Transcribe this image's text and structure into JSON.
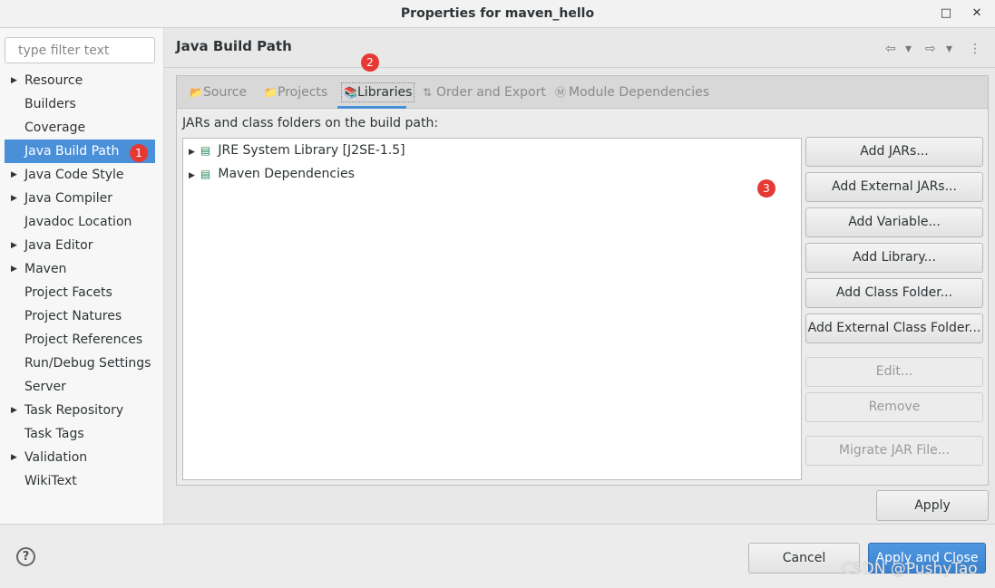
{
  "window": {
    "title": "Properties for maven_hello",
    "minimize": "▫",
    "close": "✕"
  },
  "sidebar": {
    "filter_placeholder": "type filter text",
    "items": [
      {
        "label": "Resource",
        "expandable": true
      },
      {
        "label": "Builders",
        "expandable": false
      },
      {
        "label": "Coverage",
        "expandable": false
      },
      {
        "label": "Java Build Path",
        "expandable": false,
        "selected": true
      },
      {
        "label": "Java Code Style",
        "expandable": true
      },
      {
        "label": "Java Compiler",
        "expandable": true
      },
      {
        "label": "Javadoc Location",
        "expandable": false
      },
      {
        "label": "Java Editor",
        "expandable": true
      },
      {
        "label": "Maven",
        "expandable": true
      },
      {
        "label": "Project Facets",
        "expandable": false
      },
      {
        "label": "Project Natures",
        "expandable": false
      },
      {
        "label": "Project References",
        "expandable": false
      },
      {
        "label": "Run/Debug Settings",
        "expandable": false
      },
      {
        "label": "Server",
        "expandable": false
      },
      {
        "label": "Task Repository",
        "expandable": true
      },
      {
        "label": "Task Tags",
        "expandable": false
      },
      {
        "label": "Validation",
        "expandable": true
      },
      {
        "label": "WikiText",
        "expandable": false
      }
    ]
  },
  "badges": [
    "1",
    "2",
    "3"
  ],
  "page": {
    "title": "Java Build Path",
    "nav": {
      "back": "⇦",
      "forward": "⇨",
      "dropdown": "▾",
      "menu": "⋮"
    }
  },
  "tabs": [
    {
      "label": "Source",
      "icon": "source-folder-icon"
    },
    {
      "label": "Projects",
      "icon": "projects-folder-icon"
    },
    {
      "label": "Libraries",
      "icon": "library-icon",
      "active": true
    },
    {
      "label": "Order and Export",
      "icon": "order-arrows-icon"
    },
    {
      "label": "Module Dependencies",
      "icon": "module-icon"
    }
  ],
  "libraries": {
    "label": "JARs and class folders on the build path:",
    "entries": [
      "JRE System Library [J2SE-1.5]",
      "Maven Dependencies"
    ],
    "buttons": [
      {
        "label": "Add JARs...",
        "enabled": true
      },
      {
        "label": "Add External JARs...",
        "enabled": true
      },
      {
        "label": "Add Variable...",
        "enabled": true
      },
      {
        "label": "Add Library...",
        "enabled": true
      },
      {
        "label": "Add Class Folder...",
        "enabled": true
      },
      {
        "label": "Add External Class Folder...",
        "enabled": true
      },
      {
        "label": "Edit...",
        "enabled": false
      },
      {
        "label": "Remove",
        "enabled": false
      },
      {
        "label": "Migrate JAR File...",
        "enabled": false
      }
    ]
  },
  "footer": {
    "apply": "Apply",
    "cancel": "Cancel",
    "apply_close": "Apply and Close",
    "help": "?"
  },
  "watermark": "CSDN @PushyTao",
  "colors": {
    "accent": "#4a90d9",
    "badge": "#e53935"
  }
}
